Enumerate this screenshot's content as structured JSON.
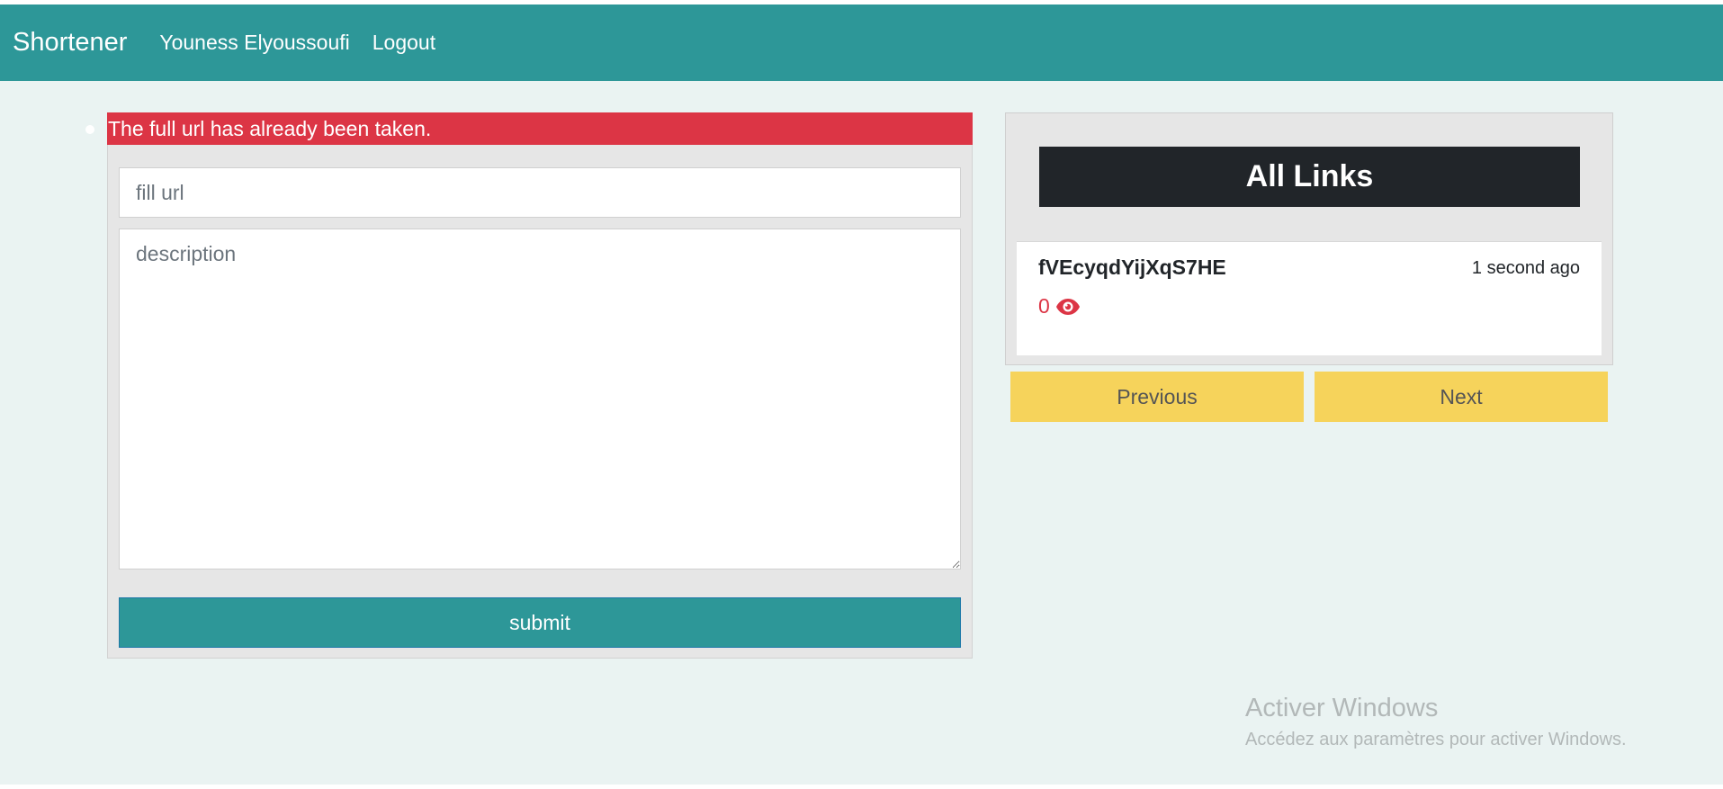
{
  "navbar": {
    "brand": "Shortener",
    "user_name": "Youness Elyoussoufi",
    "logout_label": "Logout"
  },
  "form": {
    "error_message": "The full url has already been taken.",
    "url_placeholder": "fill url",
    "url_value": "",
    "description_placeholder": "description",
    "description_value": "",
    "submit_label": "submit"
  },
  "links": {
    "header": "All Links",
    "items": [
      {
        "code": "fVEcyqdYijXqS7HE",
        "time": "1 second ago",
        "views": "0",
        "views_icon": "eye-icon"
      }
    ],
    "previous_label": "Previous",
    "next_label": "Next"
  },
  "watermark": {
    "title": "Activer Windows",
    "subtitle": "Accédez aux paramètres pour activer Windows."
  },
  "colors": {
    "accent": "#2d9798",
    "error": "#dc3545",
    "dark": "#212529",
    "pager": "#f6d35b",
    "background": "#eaf3f2"
  }
}
